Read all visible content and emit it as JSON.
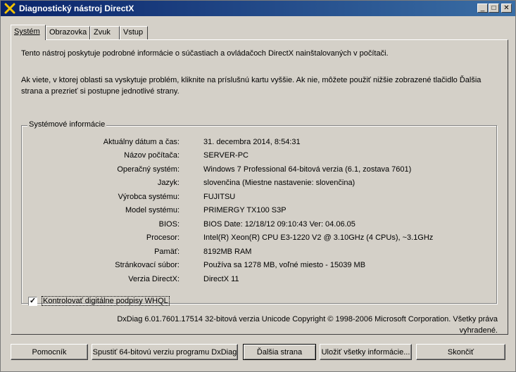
{
  "window": {
    "title": "Diagnostický nástroj DirectX"
  },
  "title_buttons": {
    "minimize": "_",
    "maximize": "□",
    "close": "✕"
  },
  "tabs": [
    {
      "label": "Systém",
      "active": true
    },
    {
      "label": "Obrazovka",
      "active": false
    },
    {
      "label": "Zvuk",
      "active": false
    },
    {
      "label": "Vstup",
      "active": false
    }
  ],
  "intro": {
    "line1": "Tento nástroj poskytuje podrobné informácie o súčastiach a ovládačoch DirectX nainštalovaných v počítači.",
    "line2a": "Ak viete, v ktorej oblasti sa vyskytuje problém, kliknite na príslušnú kartu vyššie. Ak nie, môžete použiť nižšie zobrazené tlačidlo Ďalšia",
    "line2b": "strana a prezrieť si postupne jednotlivé strany."
  },
  "sysinfo": {
    "title": "Systémové informácie",
    "rows": [
      {
        "label": "Aktuálny dátum a čas:",
        "value": "31. decembra 2014, 8:54:31"
      },
      {
        "label": "Názov počítača:",
        "value": "SERVER-PC"
      },
      {
        "label": "Operačný systém:",
        "value": "Windows 7 Professional 64-bitová verzia (6.1, zostava 7601)"
      },
      {
        "label": "Jazyk:",
        "value": "slovenčina (Miestne nastavenie: slovenčina)"
      },
      {
        "label": "Výrobca systému:",
        "value": "FUJITSU"
      },
      {
        "label": "Model systému:",
        "value": "PRIMERGY TX100 S3P"
      },
      {
        "label": "BIOS:",
        "value": "BIOS Date: 12/18/12 09:10:43 Ver: 04.06.05"
      },
      {
        "label": "Procesor:",
        "value": "Intel(R) Xeon(R) CPU E3-1220 V2 @ 3.10GHz (4 CPUs), ~3.1GHz"
      },
      {
        "label": "Pamäť:",
        "value": "8192MB RAM"
      },
      {
        "label": "Stránkovací súbor:",
        "value": "Používa sa 1278 MB, voľné miesto - 15039 MB"
      },
      {
        "label": "Verzia DirectX:",
        "value": "DirectX 11"
      }
    ],
    "whql_checkbox": {
      "label": "Kontrolovať digitálne podpisy WHQL",
      "checked": true,
      "mark": "✓"
    }
  },
  "copyright": {
    "line1": "DxDiag 6.01.7601.17514 32-bitová verzia Unicode Copyright © 1998-2006 Microsoft Corporation. Všetky práva",
    "line2": "vyhradené."
  },
  "buttons": {
    "help": "Pomocník",
    "run64": "Spustiť 64-bitovú verziu programu DxDiag",
    "next": "Ďalšia strana",
    "save": "Uložiť všetky informácie...",
    "exit": "Skončiť"
  }
}
